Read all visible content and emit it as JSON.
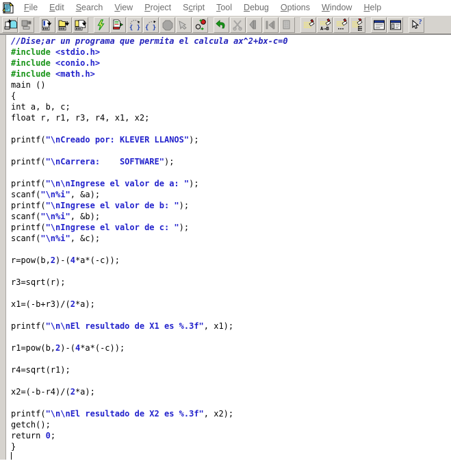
{
  "window": {
    "app_icon": "document-app-icon"
  },
  "menubar": {
    "items": [
      {
        "label": "File",
        "accel": "F"
      },
      {
        "label": "Edit",
        "accel": "E"
      },
      {
        "label": "Search",
        "accel": "S"
      },
      {
        "label": "View",
        "accel": "V"
      },
      {
        "label": "Project",
        "accel": "P"
      },
      {
        "label": "Script",
        "accel": "c"
      },
      {
        "label": "Tool",
        "accel": "T"
      },
      {
        "label": "Debug",
        "accel": "D"
      },
      {
        "label": "Options",
        "accel": "O"
      },
      {
        "label": "Window",
        "accel": "W"
      },
      {
        "label": "Help",
        "accel": "H"
      }
    ]
  },
  "toolbar": {
    "groups": [
      {
        "buttons": [
          {
            "icon": "open-file-icon",
            "enabled": true
          },
          {
            "icon": "save-file-icon",
            "enabled": false
          }
        ]
      },
      {
        "buttons": [
          {
            "icon": "compile-icon",
            "enabled": true
          },
          {
            "icon": "build-project-icon",
            "enabled": true
          },
          {
            "icon": "rebuild-all-icon",
            "enabled": true
          }
        ]
      },
      {
        "buttons": [
          {
            "icon": "run-lightning-icon",
            "enabled": true
          },
          {
            "icon": "compile-and-run-icon",
            "enabled": true
          },
          {
            "icon": "step-into-icon",
            "enabled": true
          },
          {
            "icon": "step-over-icon",
            "enabled": true
          },
          {
            "icon": "stop-icon",
            "enabled": false
          },
          {
            "icon": "pointer-hand-icon",
            "enabled": false
          },
          {
            "icon": "breakpoint-icon",
            "enabled": true
          }
        ]
      },
      {
        "buttons": [
          {
            "icon": "undo-arrow-icon",
            "enabled": true
          },
          {
            "icon": "cut-scissors-icon",
            "enabled": false
          },
          {
            "icon": "paste-icon",
            "enabled": false
          },
          {
            "icon": "indent-icon",
            "enabled": false
          },
          {
            "icon": "copy-icon",
            "enabled": false
          }
        ]
      },
      {
        "buttons": [
          {
            "icon": "find-icon",
            "enabled": true
          },
          {
            "icon": "replace-icon",
            "enabled": true
          },
          {
            "icon": "find-next-icon",
            "enabled": true
          },
          {
            "icon": "goto-line-icon",
            "enabled": true
          }
        ]
      },
      {
        "buttons": [
          {
            "icon": "window-tile-icon",
            "enabled": true
          },
          {
            "icon": "window-list-icon",
            "enabled": true
          }
        ]
      },
      {
        "buttons": [
          {
            "icon": "context-help-icon",
            "enabled": true
          }
        ]
      }
    ]
  },
  "editor": {
    "caret": {
      "line": 39,
      "column": 1
    },
    "lines": [
      {
        "tokens": [
          {
            "t": "comment",
            "v": "//Dise;ar un programa que permita el calcula ax^2+bx-c=0"
          }
        ]
      },
      {
        "tokens": [
          {
            "t": "pre",
            "v": "#include "
          },
          {
            "t": "header",
            "v": "<stdio.h>"
          }
        ]
      },
      {
        "tokens": [
          {
            "t": "pre",
            "v": "#include "
          },
          {
            "t": "header",
            "v": "<conio.h>"
          }
        ]
      },
      {
        "tokens": [
          {
            "t": "pre",
            "v": "#include "
          },
          {
            "t": "header",
            "v": "<math.h>"
          }
        ]
      },
      {
        "tokens": [
          {
            "t": "plain",
            "v": "main ()"
          }
        ]
      },
      {
        "tokens": [
          {
            "t": "plain",
            "v": "{"
          }
        ]
      },
      {
        "tokens": [
          {
            "t": "plain",
            "v": "int a, b, c;"
          }
        ]
      },
      {
        "tokens": [
          {
            "t": "plain",
            "v": "float r, r1, r3, r4, x1, x2;"
          }
        ]
      },
      {
        "tokens": []
      },
      {
        "tokens": [
          {
            "t": "plain",
            "v": "printf("
          },
          {
            "t": "str",
            "v": "\"\\nCreado por: KLEVER LLANOS\""
          },
          {
            "t": "plain",
            "v": ");"
          }
        ]
      },
      {
        "tokens": []
      },
      {
        "tokens": [
          {
            "t": "plain",
            "v": "printf("
          },
          {
            "t": "str",
            "v": "\"\\nCarrera:    SOFTWARE\""
          },
          {
            "t": "plain",
            "v": ");"
          }
        ]
      },
      {
        "tokens": []
      },
      {
        "tokens": [
          {
            "t": "plain",
            "v": "printf("
          },
          {
            "t": "str",
            "v": "\"\\n\\nIngrese el valor de a: \""
          },
          {
            "t": "plain",
            "v": ");"
          }
        ]
      },
      {
        "tokens": [
          {
            "t": "plain",
            "v": "scanf("
          },
          {
            "t": "str",
            "v": "\"\\n%i\""
          },
          {
            "t": "plain",
            "v": ", &a);"
          }
        ]
      },
      {
        "tokens": [
          {
            "t": "plain",
            "v": "printf("
          },
          {
            "t": "str",
            "v": "\"\\nIngrese el valor de b: \""
          },
          {
            "t": "plain",
            "v": ");"
          }
        ]
      },
      {
        "tokens": [
          {
            "t": "plain",
            "v": "scanf("
          },
          {
            "t": "str",
            "v": "\"\\n%i\""
          },
          {
            "t": "plain",
            "v": ", &b);"
          }
        ]
      },
      {
        "tokens": [
          {
            "t": "plain",
            "v": "printf("
          },
          {
            "t": "str",
            "v": "\"\\nIngrese el valor de c: \""
          },
          {
            "t": "plain",
            "v": ");"
          }
        ]
      },
      {
        "tokens": [
          {
            "t": "plain",
            "v": "scanf("
          },
          {
            "t": "str",
            "v": "\"\\n%i\""
          },
          {
            "t": "plain",
            "v": ", &c);"
          }
        ]
      },
      {
        "tokens": []
      },
      {
        "tokens": [
          {
            "t": "plain",
            "v": "r=pow(b,"
          },
          {
            "t": "num",
            "v": "2"
          },
          {
            "t": "plain",
            "v": ")-("
          },
          {
            "t": "num",
            "v": "4"
          },
          {
            "t": "plain",
            "v": "*a*(-c));"
          }
        ]
      },
      {
        "tokens": []
      },
      {
        "tokens": [
          {
            "t": "plain",
            "v": "r3=sqrt(r);"
          }
        ]
      },
      {
        "tokens": []
      },
      {
        "tokens": [
          {
            "t": "plain",
            "v": "x1=(-b+r3)/("
          },
          {
            "t": "num",
            "v": "2"
          },
          {
            "t": "plain",
            "v": "*a);"
          }
        ]
      },
      {
        "tokens": []
      },
      {
        "tokens": [
          {
            "t": "plain",
            "v": "printf("
          },
          {
            "t": "str",
            "v": "\"\\n\\nEl resultado de X1 es %.3f\""
          },
          {
            "t": "plain",
            "v": ", x1);"
          }
        ]
      },
      {
        "tokens": []
      },
      {
        "tokens": [
          {
            "t": "plain",
            "v": "r1=pow(b,"
          },
          {
            "t": "num",
            "v": "2"
          },
          {
            "t": "plain",
            "v": ")-("
          },
          {
            "t": "num",
            "v": "4"
          },
          {
            "t": "plain",
            "v": "*a*(-c));"
          }
        ]
      },
      {
        "tokens": []
      },
      {
        "tokens": [
          {
            "t": "plain",
            "v": "r4=sqrt(r1);"
          }
        ]
      },
      {
        "tokens": []
      },
      {
        "tokens": [
          {
            "t": "plain",
            "v": "x2=(-b-r4)/("
          },
          {
            "t": "num",
            "v": "2"
          },
          {
            "t": "plain",
            "v": "*a);"
          }
        ]
      },
      {
        "tokens": []
      },
      {
        "tokens": [
          {
            "t": "plain",
            "v": "printf("
          },
          {
            "t": "str",
            "v": "\"\\n\\nEl resultado de X2 es %.3f\""
          },
          {
            "t": "plain",
            "v": ", x2);"
          }
        ]
      },
      {
        "tokens": [
          {
            "t": "plain",
            "v": "getch();"
          }
        ]
      },
      {
        "tokens": [
          {
            "t": "plain",
            "v": "return "
          },
          {
            "t": "num",
            "v": "0"
          },
          {
            "t": "plain",
            "v": ";"
          }
        ]
      },
      {
        "tokens": [
          {
            "t": "plain",
            "v": "}"
          }
        ]
      }
    ]
  },
  "colors": {
    "comment": "#2222bb",
    "preprocessor": "#199419",
    "string": "#2222cc",
    "number": "#2222cc",
    "plain": "#000000",
    "toolbar_bg": "#d6d3ce",
    "editor_bg": "#ffffff"
  }
}
